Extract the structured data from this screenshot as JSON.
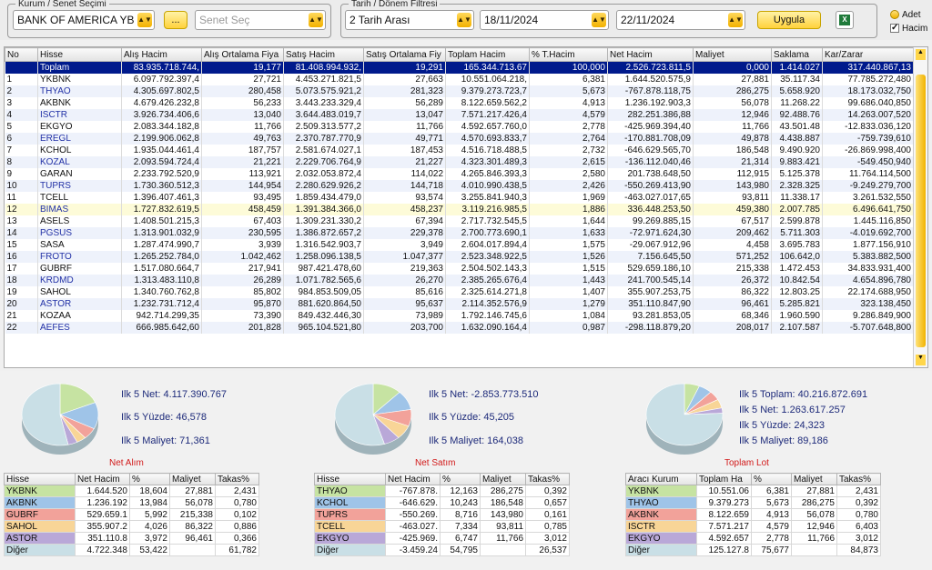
{
  "filters": {
    "kurum_group_label": "Kurum / Senet Seçimi",
    "kurum_value": "BANK OF AMERICA YB",
    "more_button": "...",
    "senet_placeholder": "Senet Seç",
    "date_group_label": "Tarih / Dönem Filtresi",
    "period_value": "2 Tarih Arası",
    "date_from": "18/11/2024",
    "date_to": "22/11/2024",
    "apply_button": "Uygula",
    "excel_label": "X"
  },
  "options": {
    "adet": "Adet",
    "hacim": "Hacim"
  },
  "grid": {
    "columns": [
      "No",
      "Hisse",
      "Alış Hacim",
      "Alış Ortalama Fiya",
      "Satış Hacim",
      "Satış Ortalama Fiy",
      "Toplam Hacim",
      "% T.Hacim",
      "Net Hacim",
      "Maliyet",
      "Saklama",
      "Kar/Zarar"
    ],
    "total": [
      "",
      "Toplam",
      "83.935.718.744,",
      "19,177",
      "81.408.994.932,",
      "19,291",
      "165.344.713.67",
      "100,000",
      "2.526.723.811,5",
      "0,000",
      "1.414.027",
      "317.440.867,13"
    ],
    "rows": [
      [
        "1",
        "YKBNK",
        "6.097.792.397,4",
        "27,721",
        "4.453.271.821,5",
        "27,663",
        "10.551.064.218,",
        "6,381",
        "1.644.520.575,9",
        "27,881",
        "35.117.34",
        "77.785.272,480"
      ],
      [
        "2",
        "THYAO",
        "4.305.697.802,5",
        "280,458",
        "5.073.575.921,2",
        "281,323",
        "9.379.273.723,7",
        "5,673",
        "-767.878.118,75",
        "286,275",
        "5.658.920",
        "18.173.032,750"
      ],
      [
        "3",
        "AKBNK",
        "4.679.426.232,8",
        "56,233",
        "3.443.233.329,4",
        "56,289",
        "8.122.659.562,2",
        "4,913",
        "1.236.192.903,3",
        "56,078",
        "11.268.22",
        "99.686.040,850"
      ],
      [
        "4",
        "ISCTR",
        "3.926.734.406,6",
        "13,040",
        "3.644.483.019,7",
        "13,047",
        "7.571.217.426,4",
        "4,579",
        "282.251.386,88",
        "12,946",
        "92.488.76",
        "14.263.007,520"
      ],
      [
        "5",
        "EKGYO",
        "2.083.344.182,8",
        "11,766",
        "2.509.313.577,2",
        "11,766",
        "4.592.657.760,0",
        "2,778",
        "-425.969.394,40",
        "11,766",
        "43.501.48",
        "-12.833.036,120"
      ],
      [
        "6",
        "EREGL",
        "2.199.906.062,8",
        "49,763",
        "2.370.787.770,9",
        "49,771",
        "4.570.693.833,7",
        "2,764",
        "-170.881.708,09",
        "49,878",
        "4.438.887",
        "-759.739,610"
      ],
      [
        "7",
        "KCHOL",
        "1.935.044.461,4",
        "187,757",
        "2.581.674.027,1",
        "187,453",
        "4.516.718.488,5",
        "2,732",
        "-646.629.565,70",
        "186,548",
        "9.490.920",
        "-26.869.998,400"
      ],
      [
        "8",
        "KOZAL",
        "2.093.594.724,4",
        "21,221",
        "2.229.706.764,9",
        "21,227",
        "4.323.301.489,3",
        "2,615",
        "-136.112.040,46",
        "21,314",
        "9.883.421",
        "-549.450,940"
      ],
      [
        "9",
        "GARAN",
        "2.233.792.520,9",
        "113,921",
        "2.032.053.872,4",
        "114,022",
        "4.265.846.393,3",
        "2,580",
        "201.738.648,50",
        "112,915",
        "5.125.378",
        "11.764.114,500"
      ],
      [
        "10",
        "TUPRS",
        "1.730.360.512,3",
        "144,954",
        "2.280.629.926,2",
        "144,718",
        "4.010.990.438,5",
        "2,426",
        "-550.269.413,90",
        "143,980",
        "2.328.325",
        "-9.249.279,700"
      ],
      [
        "11",
        "TCELL",
        "1.396.407.461,3",
        "93,495",
        "1.859.434.479,0",
        "93,574",
        "3.255.841.940,3",
        "1,969",
        "-463.027.017,65",
        "93,811",
        "11.338.17",
        "3.261.532,550"
      ],
      [
        "12",
        "BIMAS",
        "1.727.832.619,5",
        "458,459",
        "1.391.384.366,0",
        "458,237",
        "3.119.216.985,5",
        "1,886",
        "336.448.253,50",
        "459,380",
        "2.007.785",
        "6.496.641,750"
      ],
      [
        "13",
        "ASELS",
        "1.408.501.215,3",
        "67,403",
        "1.309.231.330,2",
        "67,394",
        "2.717.732.545,5",
        "1,644",
        "99.269.885,15",
        "67,517",
        "2.599.878",
        "1.445.116,850"
      ],
      [
        "14",
        "PGSUS",
        "1.313.901.032,9",
        "230,595",
        "1.386.872.657,2",
        "229,378",
        "2.700.773.690,1",
        "1,633",
        "-72.971.624,30",
        "209,462",
        "5.711.303",
        "-4.019.692,700"
      ],
      [
        "15",
        "SASA",
        "1.287.474.990,7",
        "3,939",
        "1.316.542.903,7",
        "3,949",
        "2.604.017.894,4",
        "1,575",
        "-29.067.912,96",
        "4,458",
        "3.695.783",
        "1.877.156,910"
      ],
      [
        "16",
        "FROTO",
        "1.265.252.784,0",
        "1.042,462",
        "1.258.096.138,5",
        "1.047,377",
        "2.523.348.922,5",
        "1,526",
        "7.156.645,50",
        "571,252",
        "106.642,0",
        "5.383.882,500"
      ],
      [
        "17",
        "GUBRF",
        "1.517.080.664,7",
        "217,941",
        "987.421.478,60",
        "219,363",
        "2.504.502.143,3",
        "1,515",
        "529.659.186,10",
        "215,338",
        "1.472.453",
        "34.833.931,400"
      ],
      [
        "18",
        "KRDMD",
        "1.313.483.110,8",
        "26,289",
        "1.071.782.565,6",
        "26,270",
        "2.385.265.676,4",
        "1,443",
        "241.700.545,14",
        "26,372",
        "10.842.54",
        "4.654.896,780"
      ],
      [
        "19",
        "SAHOL",
        "1.340.760.762,8",
        "85,802",
        "984.853.509,05",
        "85,616",
        "2.325.614.271,8",
        "1,407",
        "355.907.253,75",
        "86,322",
        "12.803.25",
        "22.174.688,950"
      ],
      [
        "20",
        "ASTOR",
        "1.232.731.712,4",
        "95,870",
        "881.620.864,50",
        "95,637",
        "2.114.352.576,9",
        "1,279",
        "351.110.847,90",
        "96,461",
        "5.285.821",
        "323.138,450"
      ],
      [
        "21",
        "KOZAA",
        "942.714.299,35",
        "73,390",
        "849.432.446,30",
        "73,989",
        "1.792.146.745,6",
        "1,084",
        "93.281.853,05",
        "68,346",
        "1.960.590",
        "9.286.849,900"
      ],
      [
        "22",
        "AEFES",
        "666.985.642,60",
        "201,828",
        "965.104.521,80",
        "203,700",
        "1.632.090.164,4",
        "0,987",
        "-298.118.879,20",
        "208,017",
        "2.107.587",
        "-5.707.648,800"
      ]
    ]
  },
  "panels": [
    {
      "title": "Net Alım",
      "stats": [
        "Ilk 5 Net: 4.117.390.767",
        "Ilk 5 Yüzde: 46,578",
        "Ilk 5 Maliyet: 71,361"
      ],
      "columns": [
        "Hisse",
        "Net Hacim",
        "%",
        "Maliyet",
        "Takas%"
      ],
      "rows": [
        [
          "YKBNK",
          "1.644.520",
          "18,604",
          "27,881",
          "2,431"
        ],
        [
          "AKBNK",
          "1.236.192",
          "13,984",
          "56,078",
          "0,780"
        ],
        [
          "GUBRF",
          "529.659.1",
          "5,992",
          "215,338",
          "0,102"
        ],
        [
          "SAHOL",
          "355.907.2",
          "4,026",
          "86,322",
          "0,886"
        ],
        [
          "ASTOR",
          "351.110.8",
          "3,972",
          "96,461",
          "0,366"
        ],
        [
          "Diğer",
          "4.722.348",
          "53,422",
          "",
          "61,782"
        ]
      ],
      "slices": [
        18.604,
        13.984,
        5.992,
        4.026,
        3.972,
        53.422
      ]
    },
    {
      "title": "Net Satım",
      "stats": [
        "Ilk 5 Net: -2.853.773.510",
        "Ilk 5 Yüzde: 45,205",
        "Ilk 5 Maliyet: 164,038"
      ],
      "columns": [
        "Hisse",
        "Net Hacim",
        "%",
        "Maliyet",
        "Takas%"
      ],
      "rows": [
        [
          "THYAO",
          "-767.878.",
          "12,163",
          "286,275",
          "0,392"
        ],
        [
          "KCHOL",
          "-646.629.",
          "10,243",
          "186,548",
          "0,657"
        ],
        [
          "TUPRS",
          "-550.269.",
          "8,716",
          "143,980",
          "0,161"
        ],
        [
          "TCELL",
          "-463.027.",
          "7,334",
          "93,811",
          "0,785"
        ],
        [
          "EKGYO",
          "-425.969.",
          "6,747",
          "11,766",
          "3,012"
        ],
        [
          "Diğer",
          "-3.459.24",
          "54,795",
          "",
          "26,537"
        ]
      ],
      "slices": [
        12.163,
        10.243,
        8.716,
        7.334,
        6.747,
        54.795
      ]
    },
    {
      "title": "Toplam Lot",
      "stats": [
        "Ilk 5 Toplam: 40.216.872.691",
        "Ilk 5 Net: 1.263.617.257",
        "Ilk 5 Yüzde: 24,323",
        "Ilk 5 Maliyet: 89,186"
      ],
      "columns": [
        "Aracı Kurum",
        "Toplam Ha",
        "%",
        "Maliyet",
        "Takas%"
      ],
      "rows": [
        [
          "YKBNK",
          "10.551.06",
          "6,381",
          "27,881",
          "2,431"
        ],
        [
          "THYAO",
          "9.379.273",
          "5,673",
          "286,275",
          "0,392"
        ],
        [
          "AKBNK",
          "8.122.659",
          "4,913",
          "56,078",
          "0,780"
        ],
        [
          "ISCTR",
          "7.571.217",
          "4,579",
          "12,946",
          "6,403"
        ],
        [
          "EKGYO",
          "4.592.657",
          "2,778",
          "11,766",
          "3,012"
        ],
        [
          "Diğer",
          "125.127.8",
          "75,677",
          "",
          "84,873"
        ]
      ],
      "slices": [
        6.381,
        5.673,
        4.913,
        4.579,
        2.778,
        75.677
      ]
    }
  ],
  "slice_colors": [
    "#c6e3a2",
    "#9fc4e8",
    "#f2a29a",
    "#f8d597",
    "#b9a8d8",
    "#c9dfe6"
  ]
}
